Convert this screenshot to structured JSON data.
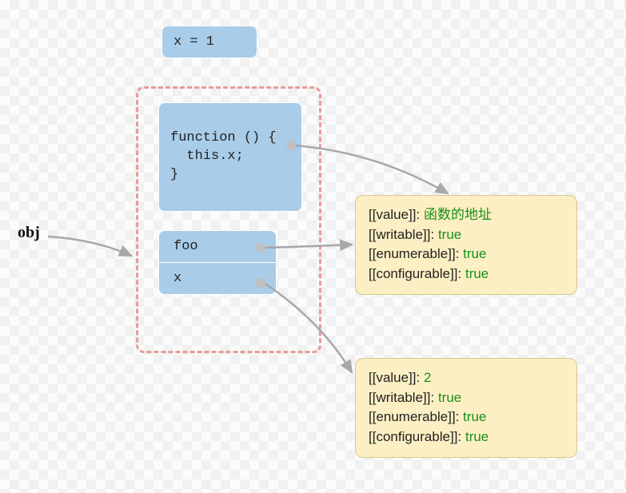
{
  "boxes": {
    "assignment": "x = 1",
    "funcLines": [
      "function () {",
      "  this.x;",
      "}"
    ],
    "foo": "foo",
    "x": "x"
  },
  "objLabel": "obj",
  "descriptor1": {
    "lines": [
      {
        "key": "[[value]]",
        "val": "函数的地址"
      },
      {
        "key": "[[writable]]",
        "val": "true"
      },
      {
        "key": "[[enumerable]]",
        "val": "true"
      },
      {
        "key": "[[configurable]]",
        "val": "true"
      }
    ]
  },
  "descriptor2": {
    "lines": [
      {
        "key": "[[value]]",
        "val": "2"
      },
      {
        "key": "[[writable]]",
        "val": "true"
      },
      {
        "key": "[[enumerable]]",
        "val": "true"
      },
      {
        "key": "[[configurable]]",
        "val": "true"
      }
    ]
  }
}
